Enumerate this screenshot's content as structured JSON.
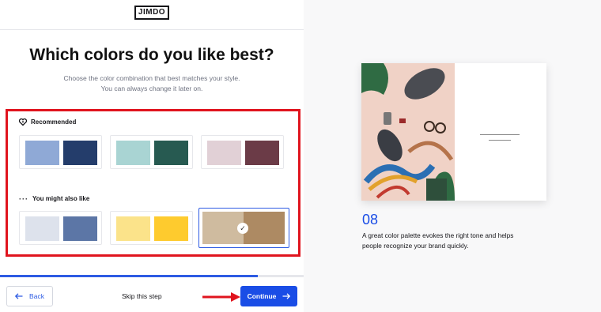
{
  "header": {
    "logo_text": "JIMDO"
  },
  "main": {
    "title": "Which colors do you like best?",
    "subtitle_line1": "Choose the color combination that best matches your style.",
    "subtitle_line2": "You can always change it later on."
  },
  "recommended": {
    "label": "Recommended",
    "palettes": [
      {
        "color_a": "#8fa9d6",
        "color_b": "#243d6b",
        "selected": false
      },
      {
        "color_a": "#a9d4d3",
        "color_b": "#275a51",
        "selected": false
      },
      {
        "color_a": "#e1d0d6",
        "color_b": "#6b3b47",
        "selected": false
      }
    ]
  },
  "also_like": {
    "label": "You might also like",
    "palettes": [
      {
        "color_a": "#dde2ec",
        "color_b": "#5c76a6",
        "selected": false
      },
      {
        "color_a": "#fbe38a",
        "color_b": "#fecb2e",
        "selected": false
      },
      {
        "color_a": "#cfbb9f",
        "color_b": "#ad8a63",
        "selected": true
      }
    ]
  },
  "progress": {
    "fraction": 0.85
  },
  "footer": {
    "back_label": "Back",
    "skip_label": "Skip this step",
    "continue_label": "Continue"
  },
  "preview": {
    "step_number": "08",
    "description_line1": "A great color palette evokes the right tone and helps",
    "description_line2": "people recognize your brand quickly."
  },
  "colors": {
    "accent": "#1a4de6",
    "highlight_annotation": "#e0141e",
    "photo_background": "#f0d2c6"
  },
  "icons": {
    "recommended": "heart-icon",
    "also_like": "ellipsis-icon",
    "selected": "check-icon",
    "back": "arrow-left-icon",
    "continue": "arrow-right-icon",
    "annotation": "red-arrow-icon"
  }
}
